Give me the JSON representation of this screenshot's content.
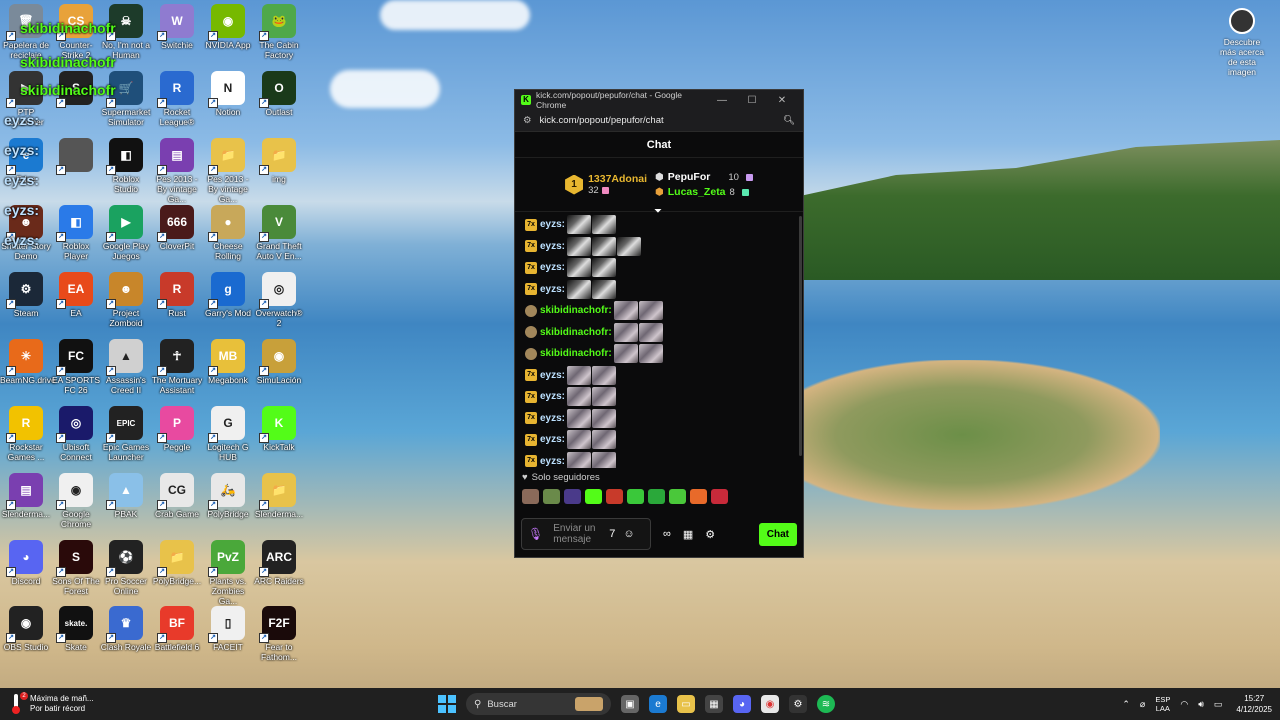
{
  "desktop": {
    "icons": [
      {
        "label": "Papelera de reciclaje",
        "color": "#7a8a9a",
        "glyph": "🗑"
      },
      {
        "label": "Counter-Strike 2",
        "color": "#e8a23a",
        "glyph": "CS"
      },
      {
        "label": "No, I'm not a Human",
        "color": "#1d3b2a",
        "glyph": "☠"
      },
      {
        "label": "Switchie",
        "color": "#8f7bd0",
        "glyph": "W"
      },
      {
        "label": "NVIDIA App",
        "color": "#76b900",
        "glyph": "◉"
      },
      {
        "label": "The Cabin Factory",
        "color": "#4fa84a",
        "glyph": "🐸"
      },
      {
        "label": "PTP Launcher",
        "color": "#333333",
        "glyph": "▶"
      },
      {
        "label": "",
        "color": "#222222",
        "glyph": "S"
      },
      {
        "label": "Supermarket Simulator",
        "color": "#1f4f7a",
        "glyph": "🛒"
      },
      {
        "label": "Rocket League®",
        "color": "#2a6ad0",
        "glyph": "R"
      },
      {
        "label": "Notion",
        "color": "#ffffff",
        "glyph": "N"
      },
      {
        "label": "Outlast",
        "color": "#1a3a1a",
        "glyph": "O"
      },
      {
        "label": "Edge",
        "color": "#1b7ad1",
        "glyph": "e"
      },
      {
        "label": "",
        "color": "#555555",
        "glyph": ""
      },
      {
        "label": "Roblox Studio",
        "color": "#111111",
        "glyph": "◧"
      },
      {
        "label": "Pes 2013 - By vintage Ga...",
        "color": "#7a3fb0",
        "glyph": "▤"
      },
      {
        "label": "Pes 2013 - By vintage Ga...",
        "color": "#e8c24a",
        "glyph": "📁"
      },
      {
        "label": "img",
        "color": "#e8c24a",
        "glyph": "📁"
      },
      {
        "label": "Shutter Story Demo",
        "color": "#6a2a1a",
        "glyph": "☻"
      },
      {
        "label": "Roblox Player",
        "color": "#2a7ae8",
        "glyph": "◧"
      },
      {
        "label": "Google Play Juegos",
        "color": "#1aa260",
        "glyph": "▶"
      },
      {
        "label": "CloverPit",
        "color": "#4a1a1a",
        "glyph": "666"
      },
      {
        "label": "Cheese Rolling",
        "color": "#c8a85a",
        "glyph": "●"
      },
      {
        "label": "Grand Theft Auto V En...",
        "color": "#4a8a3a",
        "glyph": "V"
      },
      {
        "label": "Steam",
        "color": "#1b2838",
        "glyph": "⚙"
      },
      {
        "label": "EA",
        "color": "#e84a1a",
        "glyph": "EA"
      },
      {
        "label": "Project Zomboid",
        "color": "#c8862a",
        "glyph": "☻"
      },
      {
        "label": "Rust",
        "color": "#c83a2a",
        "glyph": "R"
      },
      {
        "label": "Garry's Mod",
        "color": "#1a6ad0",
        "glyph": "g"
      },
      {
        "label": "Overwatch® 2",
        "color": "#f0f0f0",
        "glyph": "◎"
      },
      {
        "label": "BeamNG.drive",
        "color": "#e86a1a",
        "glyph": "✳"
      },
      {
        "label": "EA SPORTS FC 26",
        "color": "#111111",
        "glyph": "FC"
      },
      {
        "label": "Assassin's Creed II",
        "color": "#d0d0d0",
        "glyph": "▲"
      },
      {
        "label": "The Mortuary Assistant",
        "color": "#222222",
        "glyph": "☥"
      },
      {
        "label": "Megabonk",
        "color": "#e8c03a",
        "glyph": "MB"
      },
      {
        "label": "SimuLación",
        "color": "#c8a03a",
        "glyph": "◉"
      },
      {
        "label": "Rockstar Games ...",
        "color": "#f2c200",
        "glyph": "R"
      },
      {
        "label": "Ubisoft Connect",
        "color": "#1a1a6a",
        "glyph": "◎"
      },
      {
        "label": "Epic Games Launcher",
        "color": "#222222",
        "glyph": "EPIC"
      },
      {
        "label": "Peggle",
        "color": "#e84aa0",
        "glyph": "P"
      },
      {
        "label": "Logitech G HUB",
        "color": "#f0f0f0",
        "glyph": "G"
      },
      {
        "label": "KickTalk",
        "color": "#53fc18",
        "glyph": "K"
      },
      {
        "label": "Slenderma...",
        "color": "#7a3fb0",
        "glyph": "▤"
      },
      {
        "label": "Google Chrome",
        "color": "#f0f0f0",
        "glyph": "◉"
      },
      {
        "label": "PBAK",
        "color": "#8ac0e8",
        "glyph": "▲"
      },
      {
        "label": "Crab Game",
        "color": "#e8e8e8",
        "glyph": "CG"
      },
      {
        "label": "PolyBridge",
        "color": "#e8e8e8",
        "glyph": "🛵"
      },
      {
        "label": "Slenderma...",
        "color": "#e8c24a",
        "glyph": "📁"
      },
      {
        "label": "Discord",
        "color": "#5865f2",
        "glyph": "◕"
      },
      {
        "label": "Sons Of The Forest",
        "color": "#2a0a0a",
        "glyph": "S"
      },
      {
        "label": "Pro Soccer Online",
        "color": "#222222",
        "glyph": "⚽"
      },
      {
        "label": "PolyBridge...",
        "color": "#e8c24a",
        "glyph": "📁"
      },
      {
        "label": "Plants vs. Zombies Ga...",
        "color": "#4aa83a",
        "glyph": "PvZ"
      },
      {
        "label": "ARC Raiders",
        "color": "#222222",
        "glyph": "ARC"
      },
      {
        "label": "OBS Studio",
        "color": "#222222",
        "glyph": "◉"
      },
      {
        "label": "Skate",
        "color": "#111111",
        "glyph": "skate."
      },
      {
        "label": "Clash Royale",
        "color": "#3a6ad0",
        "glyph": "♛"
      },
      {
        "label": "Battlefield 6",
        "color": "#e83a2a",
        "glyph": "BF"
      },
      {
        "label": "FACEIT",
        "color": "#f0f0f0",
        "glyph": "▯"
      },
      {
        "label": "Fear to Fathom...",
        "color": "#1a0a0a",
        "glyph": "F2F"
      }
    ],
    "overlay_names": {
      "green": "skibidinachofr",
      "blue": "eyzs:"
    },
    "top_right_icon_label": "Descubre más acerca de esta imagen"
  },
  "window": {
    "title": "kick.com/popout/pepufor/chat - Google Chrome",
    "url": "kick.com/popout/pepufor/chat",
    "chat_header": "Chat",
    "leaderboard": {
      "first": {
        "rank": "1",
        "name": "1337Adonai",
        "count": "32"
      },
      "second": {
        "name": "PepuFor",
        "count": "10"
      },
      "third": {
        "name": "Lucas_Zeta",
        "count": "8"
      }
    },
    "messages": [
      {
        "user": "eyzs:",
        "type": "eyzs",
        "emotes": 2
      },
      {
        "user": "eyzs:",
        "type": "eyzs",
        "emotes": 3
      },
      {
        "user": "eyzs:",
        "type": "eyzs",
        "emotes": 2
      },
      {
        "user": "eyzs:",
        "type": "eyzs",
        "emotes": 2
      },
      {
        "user": "skibidinachofr:",
        "type": "skibidi",
        "emotes": 2
      },
      {
        "user": "skibidinachofr:",
        "type": "skibidi",
        "emotes": 2
      },
      {
        "user": "skibidinachofr:",
        "type": "skibidi",
        "emotes": 2
      },
      {
        "user": "eyzs:",
        "type": "eyzs",
        "emotes": 2
      },
      {
        "user": "eyzs:",
        "type": "eyzs",
        "emotes": 2
      },
      {
        "user": "eyzs:",
        "type": "eyzs",
        "emotes": 2
      },
      {
        "user": "eyzs:",
        "type": "eyzs",
        "emotes": 2
      },
      {
        "user": "eyzs:",
        "type": "eyzs",
        "emotes": 2
      }
    ],
    "followers_only": "Solo seguidores",
    "input_placeholder": "Enviar un mensaje",
    "send_label": "Chat"
  },
  "taskbar": {
    "weather_title": "Máxima de mañ...",
    "weather_sub": "Por batir récord",
    "weather_badge": "2",
    "search_placeholder": "Buscar",
    "lang_top": "ESP",
    "lang_bottom": "LAA",
    "time": "15:27",
    "date": "4/12/2025"
  },
  "colors": {
    "kick_green": "#53fc18",
    "eyzs_blue": "#bde1ff",
    "first_gold": "#e8b730",
    "third_orange": "#e8a03a"
  }
}
